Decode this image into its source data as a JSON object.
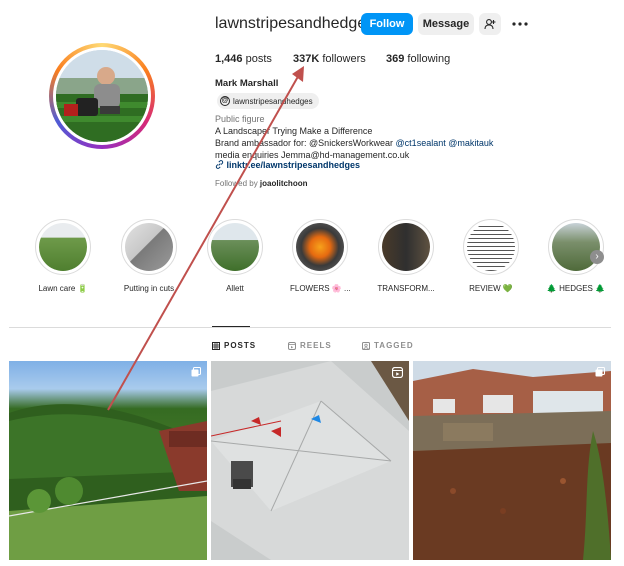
{
  "profile": {
    "username": "lawnstripesandhedges",
    "follow_label": "Follow",
    "message_label": "Message",
    "posts_count": "1,446",
    "posts_label": "posts",
    "followers_count": "337K",
    "followers_label": "followers",
    "following_count": "369",
    "following_label": "following",
    "full_name": "Mark Marshall",
    "threads_handle": "lawnstripesandhedges",
    "category": "Public figure",
    "bio_line1": "A Landscaper Trying Make a Difference",
    "bio_line2_prefix": "Brand ambassador for: @SnickersWorkwear ",
    "bio_mention1": "@ct1sealant",
    "bio_mention2": "@makitauk",
    "bio_line3": "media enquiries Jemma@hd-management.co.uk",
    "link": "linktr.ee/lawnstripesandhedges",
    "followed_by_prefix": "Followed by",
    "followed_by_user": "joaolitchoon"
  },
  "highlights": [
    {
      "label": "Lawn care 🔋"
    },
    {
      "label": "Putting in cuts"
    },
    {
      "label": "Allett"
    },
    {
      "label": "FLOWERS 🌸 ..."
    },
    {
      "label": "TRANSFORM..."
    },
    {
      "label": "REVIEW 💚"
    },
    {
      "label": "🌲 HEDGES 🌲"
    }
  ],
  "tabs": {
    "posts": "POSTS",
    "reels": "REELS",
    "tagged": "TAGGED"
  },
  "colors": {
    "follow_button": "#0095f6",
    "annotation_arrow": "#c0504d"
  },
  "icons": [
    "add-person-icon",
    "more-icon",
    "threads-icon",
    "link-icon",
    "grid-icon",
    "reels-icon",
    "tagged-icon",
    "reel-badge-icon",
    "multi-post-icon",
    "chevron-right-icon"
  ]
}
